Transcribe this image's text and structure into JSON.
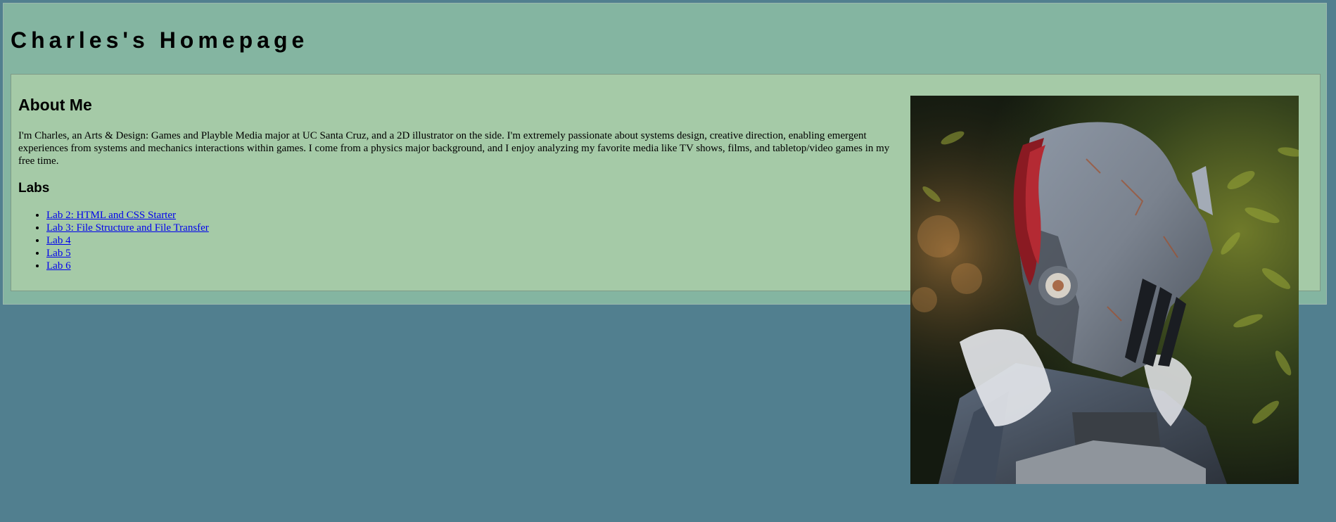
{
  "header": {
    "title": "Charles's Homepage"
  },
  "about": {
    "heading": "About Me",
    "text": "I'm Charles, an Arts & Design: Games and Playble Media major at UC Santa Cruz, and a 2D illustrator on the side. I'm extremely passionate about systems design, creative direction, enabling emergent experiences from systems and mechanics interactions within games. I come from a physics major background, and I enjoy analyzing my favorite media like TV shows, films, and tabletop/video games in my free time."
  },
  "labs": {
    "heading": "Labs",
    "items": [
      {
        "label": "Lab 2: HTML and CSS Starter"
      },
      {
        "label": "Lab 3: File Structure and File Transfer"
      },
      {
        "label": "Lab 4"
      },
      {
        "label": "Lab 5"
      },
      {
        "label": "Lab 6"
      }
    ]
  },
  "photo": {
    "subject": "cosplay helmet with red plume and white fur collar in front of foliage"
  },
  "colors": {
    "page_background": "#517f8f",
    "outer_panel": "#84b5a1",
    "inner_panel": "#a5caa7",
    "link": "#0000ee"
  }
}
